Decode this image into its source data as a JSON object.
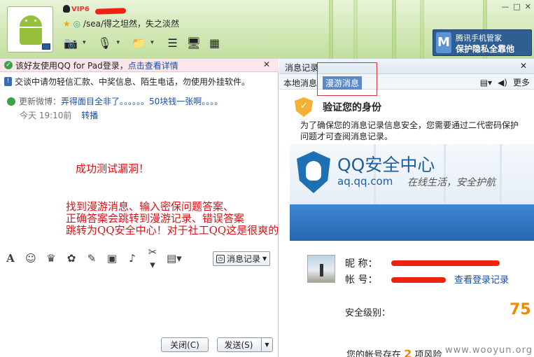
{
  "header": {
    "vip": "VIP6",
    "status_text": "/sea/得之坦然，失之淡然",
    "qqguard_line1": "腾讯手机管家",
    "qqguard_line2": "保护隐私全靠他"
  },
  "chat": {
    "notice_text": "该好友使用QQ for Pad登录，",
    "notice_link": "点击查看详情",
    "warn_text": "交谈中请勿轻信汇款、中奖信息、陌生电话，勿使用外挂软件。",
    "weibo_prefix": "更新微博：",
    "weibo_content": "弄得面目全非了。。。。。。50块钱一张啊。。。。",
    "weibo_time": "今天 19:10前",
    "weibo_retweet": "转播",
    "red_note_1": "成功测试漏洞！",
    "red_note_2_lines": [
      "找到漫游消息、输入密保问题答案、",
      "正确答案会跳转到漫游记录、错误答案",
      "跳转为QQ安全中心！对于社工QQ这是很爽的BUG"
    ],
    "msg_record_btn": "消息记录",
    "close_btn": "关闭(C)",
    "send_btn": "发送(S)"
  },
  "record_panel": {
    "title": "消息记录",
    "tab_local": "本地消息",
    "tab_roam": "漫游消息",
    "more": "更多",
    "verify_title": "验证您的身份",
    "verify_desc": "为了确保您的消息记录信息安全，您需要通过二代密码保护问题才可查阅消息记录。",
    "banner_name": "QQ安全中心",
    "banner_url": "aq.qq.com",
    "banner_slogan": "在线生活，安全护航",
    "nick_label": "昵    称：",
    "account_label": "帐    号：",
    "login_link": "查看登录记录",
    "sec_level_label": "安全级别：",
    "sec_score": "75",
    "risk_prefix": "您的帐号存在",
    "risk_count": "2",
    "risk_suffix": "项风险"
  },
  "watermark": "www.wooyun.org"
}
